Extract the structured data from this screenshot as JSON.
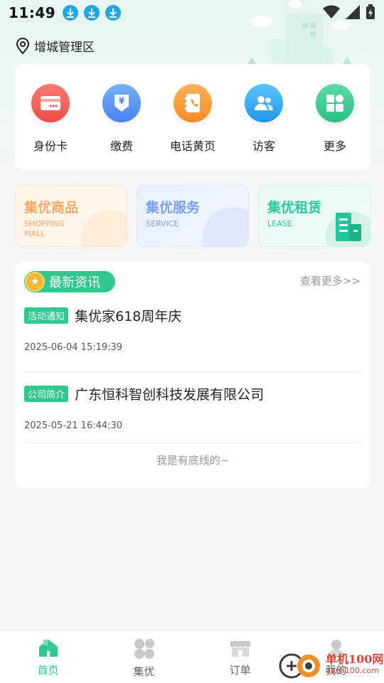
{
  "status_bar": {
    "time": "11:49",
    "notification_icons": [
      "download-icon",
      "download-icon",
      "download-icon"
    ],
    "right_icons": [
      "wifi-icon",
      "signal-icon",
      "battery-charging-icon"
    ]
  },
  "location": {
    "icon": "location-pin-icon",
    "text": "增城管理区"
  },
  "quick_actions": [
    {
      "label": "身份卡",
      "icon": "id-card-icon",
      "color": "#f05a56"
    },
    {
      "label": "缴费",
      "icon": "payment-icon",
      "color": "#4f95f3"
    },
    {
      "label": "电话黄页",
      "icon": "phone-book-icon",
      "color": "#f7922e"
    },
    {
      "label": "访客",
      "icon": "visitor-icon",
      "color": "#2ba8f0"
    },
    {
      "label": "更多",
      "icon": "more-grid-icon",
      "color": "#32c98c"
    }
  ],
  "promos": [
    {
      "title": "集优商品",
      "subtitle_1": "SHOPPING",
      "subtitle_2": "MALL",
      "color": "#fba766"
    },
    {
      "title": "集优服务",
      "subtitle_1": "SERVICE",
      "subtitle_2": "",
      "color": "#7a9ef0"
    },
    {
      "title": "集优租赁",
      "subtitle_1": "LEASE",
      "subtitle_2": "",
      "color": "#2bc79a"
    }
  ],
  "news": {
    "header": "最新资讯",
    "see_more": "查看更多>>",
    "items": [
      {
        "tag": "活动通知",
        "title": "集优家618周年庆",
        "time": "2025-06-04 15:19:39"
      },
      {
        "tag": "公司简介",
        "title": "广东恒科智创科技发展有限公司",
        "time": "2025-05-21 16:44:30"
      }
    ],
    "bottom_tip": "我是有底线的~"
  },
  "tab_bar": {
    "active_color": "#2fc98f",
    "items": [
      {
        "label": "首页",
        "icon": "home-icon",
        "active": true
      },
      {
        "label": "集优",
        "icon": "jiyou-icon",
        "active": false
      },
      {
        "label": "订单",
        "icon": "order-icon",
        "active": false
      },
      {
        "label": "我的",
        "icon": "profile-icon",
        "active": false
      }
    ]
  },
  "watermark": {
    "main": "单机100网",
    "sub": "danji100.com"
  }
}
